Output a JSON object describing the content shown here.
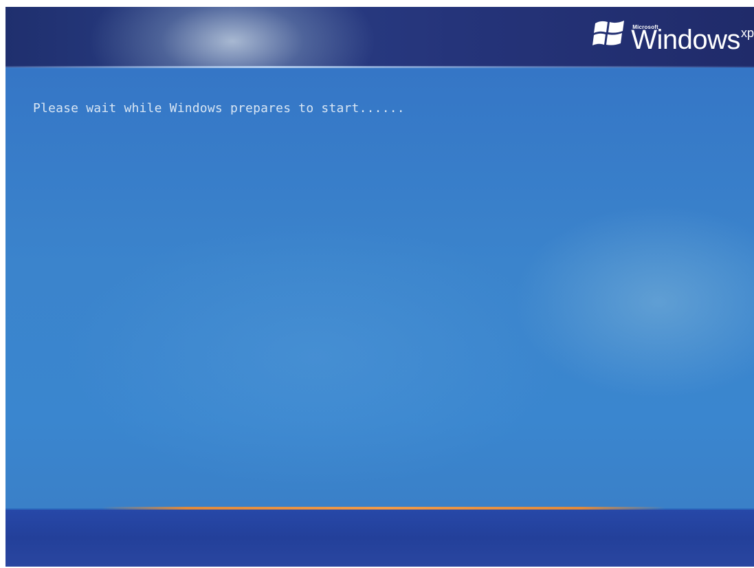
{
  "logo": {
    "microsoft_text": "Microsoft",
    "windows_text": "Windows",
    "xp_text": "xp",
    "icon": "windows-flag-icon"
  },
  "status": {
    "message": "Please wait while Windows prepares to start......"
  },
  "colors": {
    "top_band": "#25347a",
    "main_background": "#3a82cb",
    "accent_line": "#f09a48",
    "bottom_band": "#2544a0",
    "text": "#d9e6f4"
  }
}
